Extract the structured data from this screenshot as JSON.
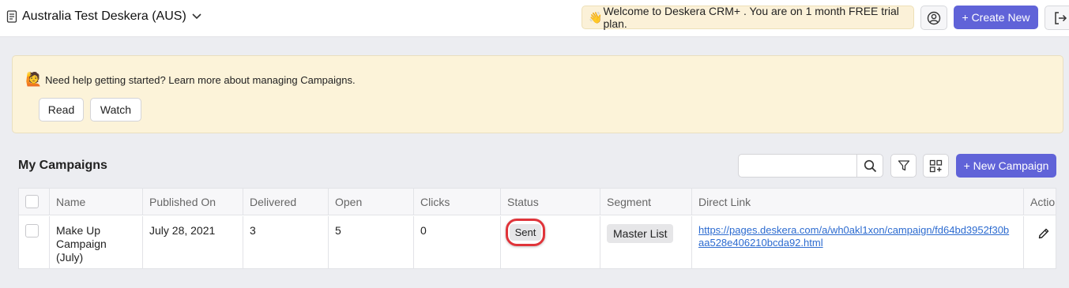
{
  "header": {
    "org_name": "Australia Test Deskera (AUS)",
    "welcome_emoji": "👋",
    "welcome_text": "Welcome to Deskera CRM+ . You are on 1 month FREE trial plan.",
    "create_label": "+ Create New"
  },
  "help": {
    "emoji": "🙋",
    "text": "Need help getting started? Learn more about managing Campaigns.",
    "read_label": "Read",
    "watch_label": "Watch"
  },
  "campaigns": {
    "title": "My Campaigns",
    "search_placeholder": "",
    "new_label": "+ New Campaign",
    "columns": [
      "Name",
      "Published On",
      "Delivered",
      "Open",
      "Clicks",
      "Status",
      "Segment",
      "Direct Link",
      "Actions"
    ],
    "rows": [
      {
        "name": "Make Up Campaign (July)",
        "published_on": "July 28, 2021",
        "delivered": "3",
        "open": "5",
        "clicks": "0",
        "status": "Sent",
        "segment": "Master List",
        "direct_link": "https://pages.deskera.com/a/wh0akl1xon/campaign/fd64bd3952f30baa528e406210bcda92.html"
      }
    ]
  },
  "colors": {
    "accent": "#6063d8",
    "banner": "#fcf3d9",
    "highlight_ring": "#e0343a",
    "link": "#2c6bd0"
  }
}
